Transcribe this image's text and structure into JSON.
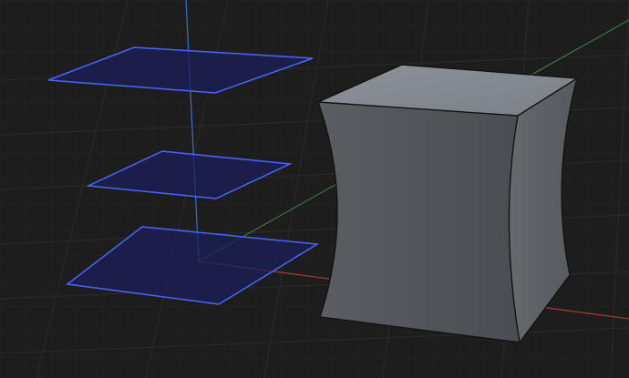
{
  "scene": {
    "background_color": "#1d1d1d",
    "grid_color": "#2a2a2a",
    "x_axis_color": "#b24545",
    "y_axis_color": "#4e8f4e",
    "z_axis_color": "#3b6fd6",
    "plane_fill_color": "#1c1f5a",
    "plane_outline_color": "#4b63ff",
    "plane_count": 3,
    "mesh_name": "",
    "mesh_type": "pinched-cube"
  },
  "colors": {
    "mesh_side_left": "#4f5357",
    "mesh_side_right": "#5c6064",
    "mesh_top": "#858b91",
    "mesh_edge": "#121212"
  }
}
